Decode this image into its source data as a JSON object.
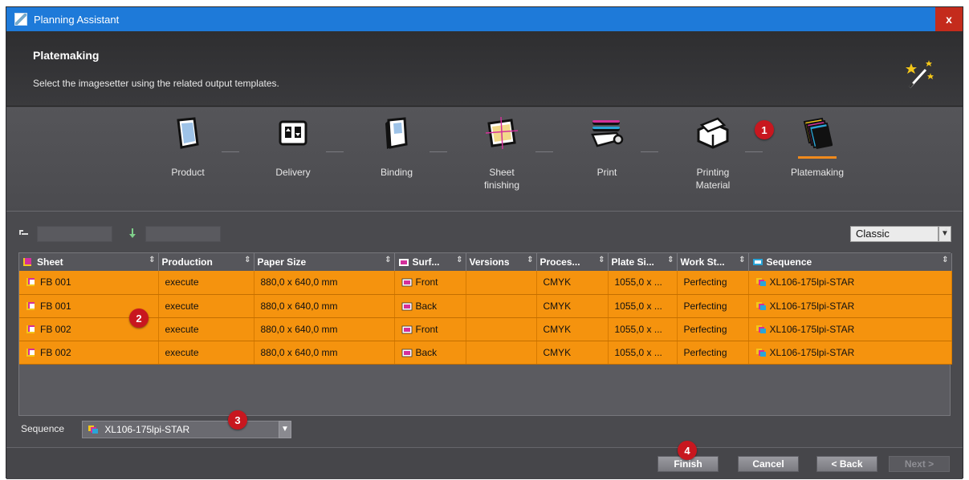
{
  "window": {
    "title": "Planning Assistant",
    "close_label": "x"
  },
  "header": {
    "title": "Platemaking",
    "subtitle": "Select the imagesetter using the related output templates."
  },
  "steps": [
    {
      "label": "Product",
      "icon": "product-icon"
    },
    {
      "label": "Delivery",
      "icon": "delivery-icon"
    },
    {
      "label": "Binding",
      "icon": "binding-icon"
    },
    {
      "label": "Sheet\nfinishing",
      "icon": "sheet-finishing-icon"
    },
    {
      "label": "Print",
      "icon": "print-icon"
    },
    {
      "label": "Printing\nMaterial",
      "icon": "printing-material-icon"
    },
    {
      "label": "Platemaking",
      "icon": "platemaking-icon",
      "active": true
    }
  ],
  "badges": {
    "b1": "1",
    "b2": "2",
    "b3": "3",
    "b4": "4"
  },
  "toolbar": {
    "view_value": "Classic",
    "asterisk": "*"
  },
  "table": {
    "columns": [
      "Sheet",
      "Production",
      "Paper Size",
      "Surf...",
      "Versions",
      "Proces...",
      "Plate Si...",
      "Work St...",
      "Sequence"
    ],
    "rows": [
      [
        "FB 001",
        "execute",
        "880,0 x 640,0 mm",
        "Front",
        "",
        "CMYK",
        "1055,0 x ...",
        "Perfecting",
        "XL106-175lpi-STAR"
      ],
      [
        "FB 001",
        "execute",
        "880,0 x 640,0 mm",
        "Back",
        "",
        "CMYK",
        "1055,0 x ...",
        "Perfecting",
        "XL106-175lpi-STAR"
      ],
      [
        "FB 002",
        "execute",
        "880,0 x 640,0 mm",
        "Front",
        "",
        "CMYK",
        "1055,0 x ...",
        "Perfecting",
        "XL106-175lpi-STAR"
      ],
      [
        "FB 002",
        "execute",
        "880,0 x 640,0 mm",
        "Back",
        "",
        "CMYK",
        "1055,0 x ...",
        "Perfecting",
        "XL106-175lpi-STAR"
      ]
    ]
  },
  "sequence": {
    "label": "Sequence",
    "value": "XL106-175lpi-STAR"
  },
  "footer": {
    "finish": "Finish",
    "cancel": "Cancel",
    "back": "< Back",
    "next": "Next >"
  },
  "colors": {
    "accent": "#f5930e",
    "titlebar": "#1e7ad9",
    "badge": "#c8171f"
  }
}
